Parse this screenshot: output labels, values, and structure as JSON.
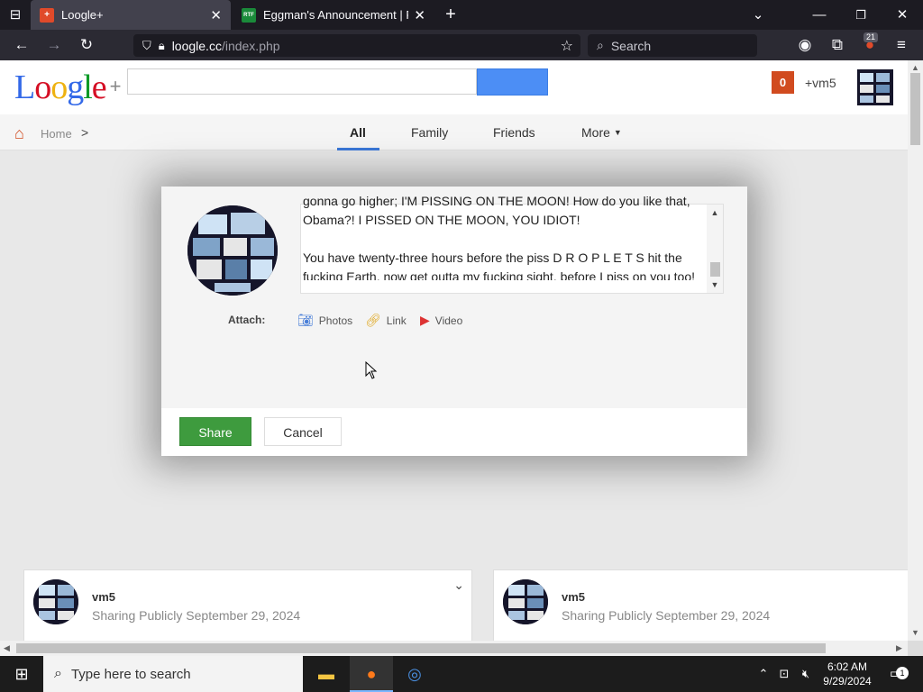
{
  "browser": {
    "tabs": [
      {
        "title": "Loogle+",
        "favicon_label": "+",
        "favicon_color": "#e04a2a",
        "active": true
      },
      {
        "title": "Eggman's Announcement | Rea",
        "favicon_label": "RTF",
        "favicon_color": "#1a8a3a",
        "active": false
      }
    ],
    "url": {
      "host": "loogle.cc",
      "path": "/index.php"
    },
    "search_placeholder": "Search",
    "extension_badge": "21"
  },
  "site": {
    "logo": {
      "text": "Loogle",
      "plus": "+",
      "letter_colors": [
        "#3369e8",
        "#d50f25",
        "#eeb211",
        "#3369e8",
        "#009925",
        "#d50f25"
      ]
    },
    "search_value": "",
    "notification_count": "0",
    "username": "+vm5",
    "breadcrumb": {
      "home": "Home",
      "separator": ">"
    },
    "nav_tabs": [
      "All",
      "Family",
      "Friends",
      "More"
    ],
    "active_tab": "All"
  },
  "dialog": {
    "text": "gonna go higher; I'M PISSING ON THE MOON! How do you like that, Obama?! I PISSED ON THE MOON, YOU IDIOT!\n\nYou have twenty-three hours before the piss D R O P L E T S hit the fucking Earth, now get outta my fucking sight, before I piss on you too!",
    "attach_label": "Attach:",
    "attach_items": [
      {
        "label": "Photos",
        "icon": "camera-icon"
      },
      {
        "label": "Link",
        "icon": "link-icon"
      },
      {
        "label": "Video",
        "icon": "video-icon"
      }
    ],
    "share_label": "Share",
    "cancel_label": "Cancel"
  },
  "posts": [
    {
      "author": "vm5",
      "visibility": "Sharing Publicly",
      "date": "September 29, 2024"
    },
    {
      "author": "vm5",
      "visibility": "Sharing Publicly",
      "date": "September 29, 2024"
    }
  ],
  "taskbar": {
    "search_placeholder": "Type here to search",
    "time": "6:02 AM",
    "date": "9/29/2024",
    "notification_count": "1"
  },
  "colors": {
    "share_button": "#3e9b3e",
    "search_button": "#4c8ef5",
    "notification_badge": "#d14b1f",
    "active_tab_underline": "#3b78d8"
  }
}
